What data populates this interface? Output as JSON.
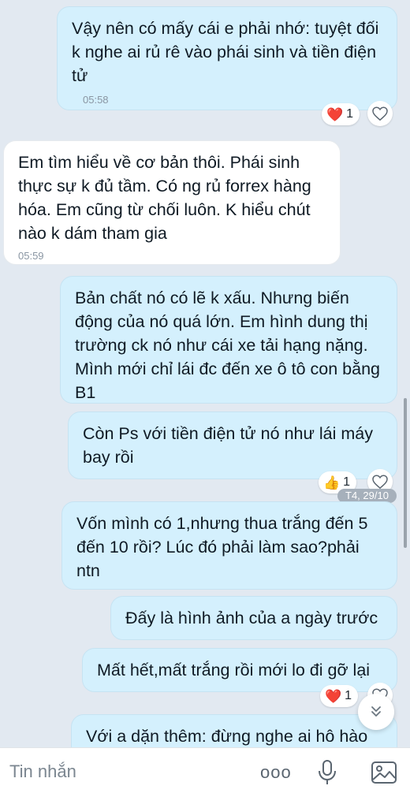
{
  "messages": [
    {
      "text": "Vậy nên có mấy cái e phải nhớ: tuyệt đối k nghe ai rủ rê vào phái sinh và tiền điện tử",
      "time": "05:58",
      "reaction_emoji": "❤️",
      "reaction_count": "1"
    },
    {
      "text": "Em tìm hiểu về cơ bản thôi. Phái sinh thực sự k đủ tầm. Có ng rủ forrex hàng hóa. Em cũng từ chối luôn. K hiểu chút nào k dám tham gia",
      "time": "05:59"
    },
    {
      "text": "Bản chất nó có lẽ k xấu. Nhưng biến động của nó quá lớn. Em hình dung thị trường ck nó như cái xe tải hạng nặng. Mình mới chỉ lái đc đến xe ô tô con bằng B1"
    },
    {
      "text": "Còn Ps với tiền điện tử nó như lái máy bay rồi",
      "reaction_emoji": "👍",
      "reaction_count": "1"
    },
    {
      "text": "Vốn mình có 1,nhưng thua trắng đến 5 đến 10 rồi? Lúc đó phải làm sao?phải ntn"
    },
    {
      "text": "Đấy là hình ảnh của a ngày trước"
    },
    {
      "text": "Mất hết,mất trắng rồi mới lo đi gỡ lại",
      "reaction_emoji": "❤️",
      "reaction_count": "1"
    },
    {
      "text": "Với a dặn thêm: đừng nghe ai hô hào"
    }
  ],
  "date_badge": "T4, 29/10",
  "composer": {
    "placeholder": "Tin nhắn",
    "more_label": "ooo"
  },
  "colors": {
    "outgoing_bubble": "#d4f0fd",
    "incoming_bubble": "#ffffff",
    "background": "#e2e9f1",
    "heart": "#e5213b"
  },
  "icons": [
    "heart-outline-icon",
    "chevron-double-down-icon",
    "microphone-icon",
    "image-icon"
  ]
}
